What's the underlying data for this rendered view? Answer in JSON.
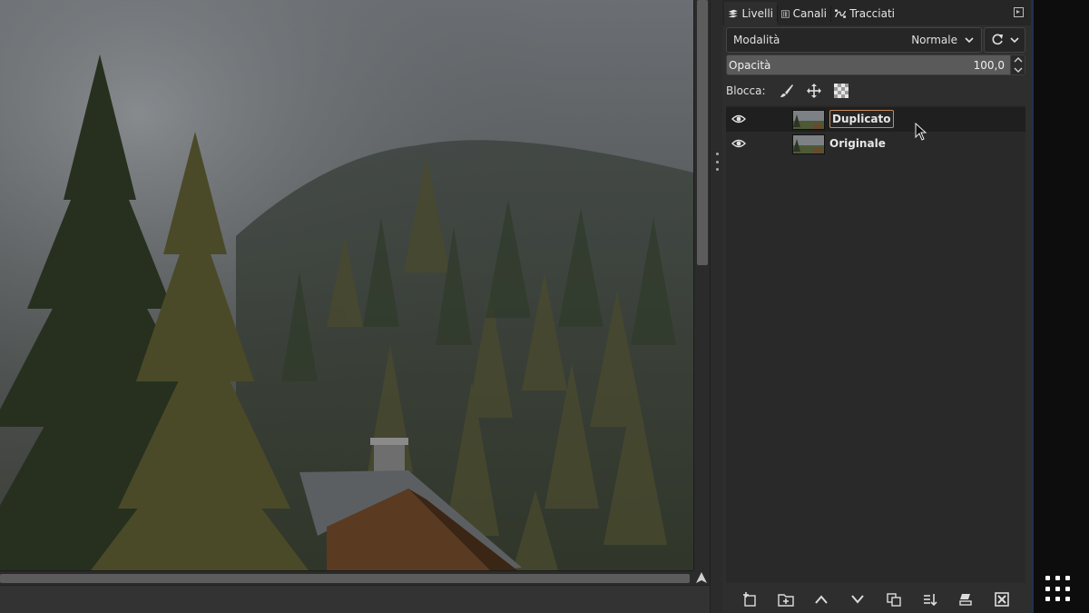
{
  "tabs": [
    {
      "label": "Livelli",
      "icon": "layers-icon",
      "active": true
    },
    {
      "label": "Canali",
      "icon": "channels-icon",
      "active": false
    },
    {
      "label": "Tracciati",
      "icon": "paths-icon",
      "active": false
    }
  ],
  "mode": {
    "label": "Modalità",
    "value": "Normale"
  },
  "opacity": {
    "label": "Opacità",
    "value": "100,0"
  },
  "lock": {
    "label": "Blocca:",
    "icons": [
      "lock-pixels-icon",
      "lock-position-icon",
      "lock-alpha-icon"
    ]
  },
  "layers": [
    {
      "name": "Duplicato",
      "visible": true,
      "selected": true,
      "editing": true
    },
    {
      "name": "Originale",
      "visible": true,
      "selected": false,
      "editing": false
    }
  ],
  "toolbar_icons": [
    "new-layer-icon",
    "new-group-icon",
    "raise-layer-icon",
    "lower-layer-icon",
    "duplicate-layer-icon",
    "merge-down-icon",
    "add-mask-icon",
    "delete-layer-icon"
  ],
  "colors": {
    "panel_bg": "#2e2e2e",
    "selection_bg": "#1f1f1f",
    "edit_border": "#c98a5a",
    "opacity_bar": "#5a5a5a"
  }
}
